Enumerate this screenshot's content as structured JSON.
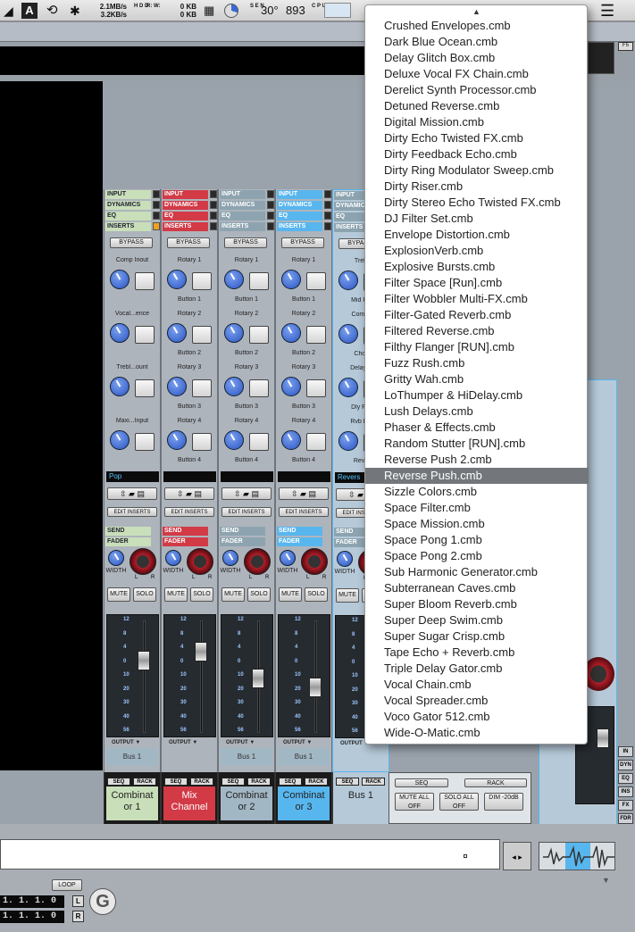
{
  "menubar": {
    "net_down": "2.1MB/s",
    "net_up": "3.2KB/s",
    "hd_read": "0 KB",
    "hd_write": "0 KB",
    "temp": "30°",
    "cpu": "893",
    "hd_labels": "H D D",
    "rw": "R: W:",
    "sen": "S E N",
    "cpu_lbl": "C P U"
  },
  "menu": {
    "items": [
      "Crushed Envelopes.cmb",
      "Dark Blue Ocean.cmb",
      "Delay Glitch Box.cmb",
      "Deluxe Vocal FX Chain.cmb",
      "Derelict Synth Processor.cmb",
      "Detuned Reverse.cmb",
      "Digital Mission.cmb",
      "Dirty Echo Twisted FX.cmb",
      "Dirty Feedback Echo.cmb",
      "Dirty Ring Modulator Sweep.cmb",
      "Dirty Riser.cmb",
      "Dirty Stereo Echo Twisted FX.cmb",
      "DJ Filter Set.cmb",
      "Envelope Distortion.cmb",
      "ExplosionVerb.cmb",
      "Explosive Bursts.cmb",
      "Filter Space [Run].cmb",
      "Filter Wobbler Multi-FX.cmb",
      "Filter-Gated Reverb.cmb",
      "Filtered Reverse.cmb",
      "Filthy Flanger [RUN].cmb",
      "Fuzz Rush.cmb",
      "Gritty Wah.cmb",
      "LoThumper & HiDelay.cmb",
      "Lush Delays.cmb",
      "Phaser & Effects.cmb",
      "Random Stutter [RUN].cmb",
      "Reverse Push 2.cmb",
      "Reverse Push.cmb",
      "Sizzle Colors.cmb",
      "Space Filter.cmb",
      "Space Mission.cmb",
      "Space Pong 1.cmb",
      "Space Pong 2.cmb",
      "Sub Harmonic Generator.cmb",
      "Subterranean Caves.cmb",
      "Super Bloom Reverb.cmb",
      "Super Deep Swim.cmb",
      "Super Sugar Crisp.cmb",
      "Tape Echo + Reverb.cmb",
      "Triple Delay Gator.cmb",
      "Vocal Chain.cmb",
      "Vocal Spreader.cmb",
      "Voco Gator 512.cmb",
      "Wide-O-Matic.cmb"
    ],
    "selected_index": 28
  },
  "lanes": {
    "input": "INPUT",
    "dynamics": "DYNAMICS",
    "eq": "EQ",
    "inserts": "INSERTS",
    "send": "SEND",
    "fader": "FADER"
  },
  "labels": {
    "bypass": "BYPASS",
    "edit_inserts": "EDIT INSERTS",
    "width": "WIDTH",
    "l": "L",
    "r": "R",
    "mute": "MUTE",
    "solo": "SOLO",
    "output": "OUTPUT ▼",
    "seq": "SEQ",
    "rack": "RACK",
    "mute_all": "MUTE ALL OFF",
    "solo_all": "SOLO ALL OFF",
    "dim": "DIM -20dB",
    "loop": "LOOP",
    "f5": "F5"
  },
  "meter_ticks": [
    "12",
    "8",
    "4",
    "0",
    "10",
    "20",
    "30",
    "40",
    "56"
  ],
  "strips": [
    {
      "color": "green",
      "knobs": [
        "Comp Inout",
        "Vocal...ence",
        "Trebl...ount",
        "Maxi...Input"
      ],
      "buttons": [
        "",
        "",
        "",
        ""
      ],
      "display": "Pop",
      "bus": "Bus 1",
      "name": "Combinat or 1",
      "fader_level": 0.3
    },
    {
      "color": "red",
      "knobs": [
        "Rotary 1",
        "Rotary 2",
        "Rotary 3",
        "Rotary 4"
      ],
      "buttons": [
        "Button 1",
        "Button 2",
        "Button 3",
        "Button 4"
      ],
      "display": "",
      "bus": "",
      "name": "Mix Channel",
      "fader_level": 0.2
    },
    {
      "color": "gray",
      "knobs": [
        "Rotary 1",
        "Rotary 2",
        "Rotary 3",
        "Rotary 4"
      ],
      "buttons": [
        "Button 1",
        "Button 2",
        "Button 3",
        "Button 4"
      ],
      "display": "",
      "bus": "Bus 1",
      "name": "Combinat or 2",
      "fader_level": 0.5
    },
    {
      "color": "blue",
      "knobs": [
        "Rotary 1",
        "Rotary 2",
        "Rotary 3",
        "Rotary 4"
      ],
      "buttons": [
        "Button 1",
        "Button 2",
        "Button 3",
        "Button 4"
      ],
      "display": "",
      "bus": "Bus 1",
      "name": "Combinat or 3",
      "fader_level": 0.6
    },
    {
      "color": "gray",
      "knobs": [
        "Treb",
        "Compr",
        "Delay L",
        "Rvb De"
      ],
      "buttons": [
        "Mid Pu",
        "Chor",
        "Dly Fla",
        "Reve"
      ],
      "display": "Revers",
      "bus": "",
      "name": "Bus 1",
      "fader_level": 0.0
    }
  ],
  "transport": {
    "pos1": "1. 1. 1.  0",
    "pos2": "1. 1. 1.  0",
    "l": "L",
    "r": "R"
  },
  "side_buttons": [
    "IN",
    "DYN",
    "EQ",
    "INS",
    "FX",
    "FDR"
  ]
}
